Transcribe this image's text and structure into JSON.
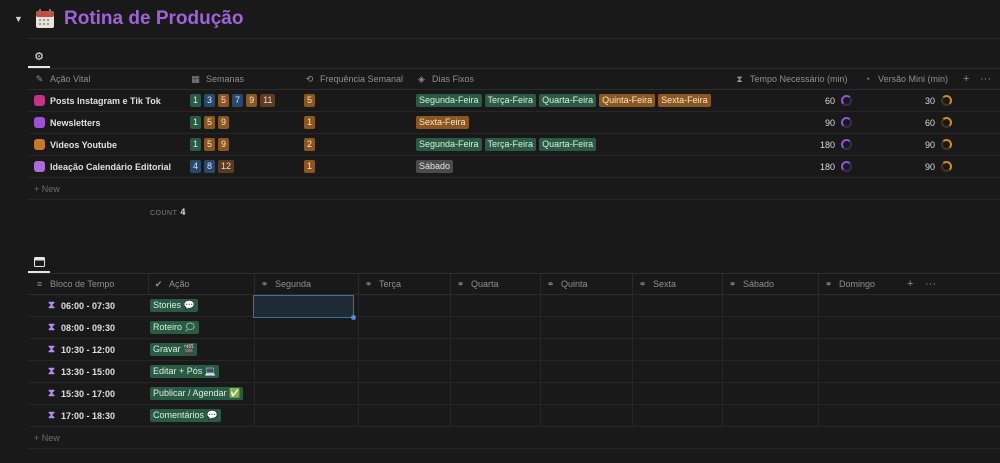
{
  "page": {
    "title": "Rotina de Produção",
    "toggle": "▼",
    "settings_icon": "gear-icon",
    "calendar_icon": "calendar-icon"
  },
  "routine_table": {
    "columns": {
      "acao": "Ação Vital",
      "semanas": "Semanas",
      "freq": "Frequência Semanal",
      "dias": "Dias Fixos",
      "tempo": "Tempo Necessário (min)",
      "mini": "Versão Mini (min)",
      "add": "+",
      "more": "···"
    },
    "rows": [
      {
        "name": "Posts Instagram e Tik Tok",
        "icon_color": "#c13584",
        "weeks": [
          "1",
          "3",
          "5",
          "7",
          "9",
          "11"
        ],
        "freq": "5",
        "days": [
          {
            "label": "Segunda-Feira",
            "color": "green"
          },
          {
            "label": "Terça-Feira",
            "color": "green"
          },
          {
            "label": "Quarta-Feira",
            "color": "green"
          },
          {
            "label": "Quinta-Feira",
            "color": "orange"
          },
          {
            "label": "Sexta-Feira",
            "color": "orange"
          }
        ],
        "tempo": "60",
        "mini": "30"
      },
      {
        "name": "Newsletters",
        "icon_color": "#a04fd6",
        "weeks": [
          "1",
          "5",
          "9"
        ],
        "freq": "1",
        "days": [
          {
            "label": "Sexta-Feira",
            "color": "orange"
          }
        ],
        "tempo": "90",
        "mini": "60"
      },
      {
        "name": "Videos Youtube",
        "icon_color": "#c9782a",
        "weeks": [
          "1",
          "5",
          "9"
        ],
        "freq": "2",
        "days": [
          {
            "label": "Segunda-Feira",
            "color": "green"
          },
          {
            "label": "Terça-Feira",
            "color": "green"
          },
          {
            "label": "Quarta-Feira",
            "color": "green"
          }
        ],
        "tempo": "180",
        "mini": "90"
      },
      {
        "name": "Ideação Calendário Editorial",
        "icon_color": "#b06ad8",
        "weeks": [
          "4",
          "8",
          "12"
        ],
        "freq": "1",
        "days": [
          {
            "label": "Sábado",
            "color": "gray"
          }
        ],
        "tempo": "180",
        "mini": "90"
      }
    ],
    "new_label": "+ New",
    "count_label": "COUNT",
    "count_value": "4"
  },
  "schedule_table": {
    "columns": [
      "Bloco de Tempo",
      "Ação",
      "Segunda",
      "Terça",
      "Quarta",
      "Quinta",
      "Sexta",
      "Sábado",
      "Domingo"
    ],
    "add": "+",
    "more": "···",
    "rows": [
      {
        "time": "06:00 - 07:30",
        "action": "Stories 💬"
      },
      {
        "time": "08:00 - 09:30",
        "action": "Roteiro 🗯"
      },
      {
        "time": "10:30 - 12:00",
        "action": "Gravar 🎬"
      },
      {
        "time": "13:30 - 15:00",
        "action": "Editar + Pós 💻"
      },
      {
        "time": "15:30 - 17:00",
        "action": "Publicar / Agendar ✅"
      },
      {
        "time": "17:00 - 18:30",
        "action": "Comentários 💬"
      }
    ],
    "new_label": "+ New"
  }
}
